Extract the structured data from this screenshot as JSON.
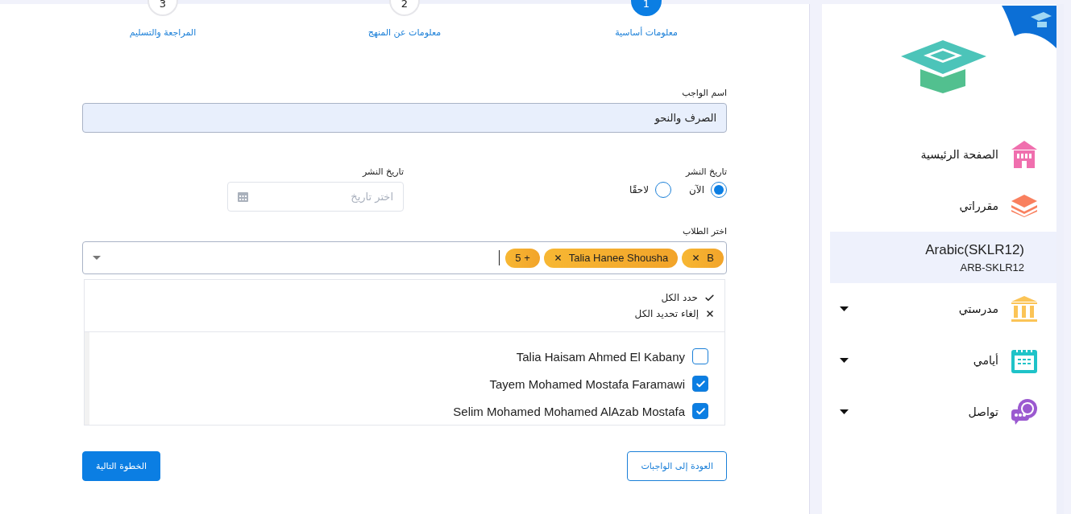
{
  "stepper": [
    {
      "number": "1",
      "label": "معلومات أساسية",
      "selected": true
    },
    {
      "number": "2",
      "label": "معلومات عن المنهج",
      "selected": false
    },
    {
      "number": "3",
      "label": "المراجعة والتسليم",
      "selected": false
    }
  ],
  "assignment_name": {
    "label": "اسم الواجب",
    "value": "الصرف والنحو"
  },
  "publish": {
    "label": "تاريخ النشر",
    "options": [
      {
        "label": "الآن",
        "selected": true
      },
      {
        "label": "لاحقًا",
        "selected": false
      }
    ]
  },
  "publish_date": {
    "label": "تاريخ النشر",
    "placeholder": "اختر تاريخ"
  },
  "students": {
    "label": "اختر الطلاب",
    "chips": [
      {
        "label": "B",
        "kind": "name"
      },
      {
        "label": "Talia Hanee Shousha",
        "kind": "name"
      },
      {
        "label": "5 +",
        "kind": "more"
      }
    ],
    "actions": [
      {
        "label": "حدد الكل",
        "kind": "select_all"
      },
      {
        "label": "إلغاء تحديد الكل",
        "kind": "deselect_all"
      }
    ],
    "options": [
      {
        "name": "Talia Haisam Ahmed El Kabany",
        "checked": false
      },
      {
        "name": "Tayem Mohamed Mostafa Faramawi",
        "checked": true
      },
      {
        "name": "Selim Mohamed Mohamed AlAzab Mostafa",
        "checked": true
      }
    ]
  },
  "buttons": [
    {
      "label": "العودة إلى الواجبات",
      "kind": "outline"
    },
    {
      "label": "الخطوة التالية",
      "kind": "primary"
    }
  ],
  "sidebar": {
    "items": [
      {
        "kind": "link",
        "label": "الصفحة الرئيسية",
        "selected": false
      },
      {
        "kind": "link",
        "label": "مقرراتي",
        "selected": false
      },
      {
        "kind": "course",
        "title": "Arabic(SKLR12)",
        "code": "ARB-SKLR12",
        "selected": true
      },
      {
        "kind": "group",
        "label": "مدرستي",
        "selected": false
      },
      {
        "kind": "group",
        "label": "أيامي",
        "selected": false
      },
      {
        "kind": "group",
        "label": "تواصل",
        "selected": false
      }
    ]
  }
}
